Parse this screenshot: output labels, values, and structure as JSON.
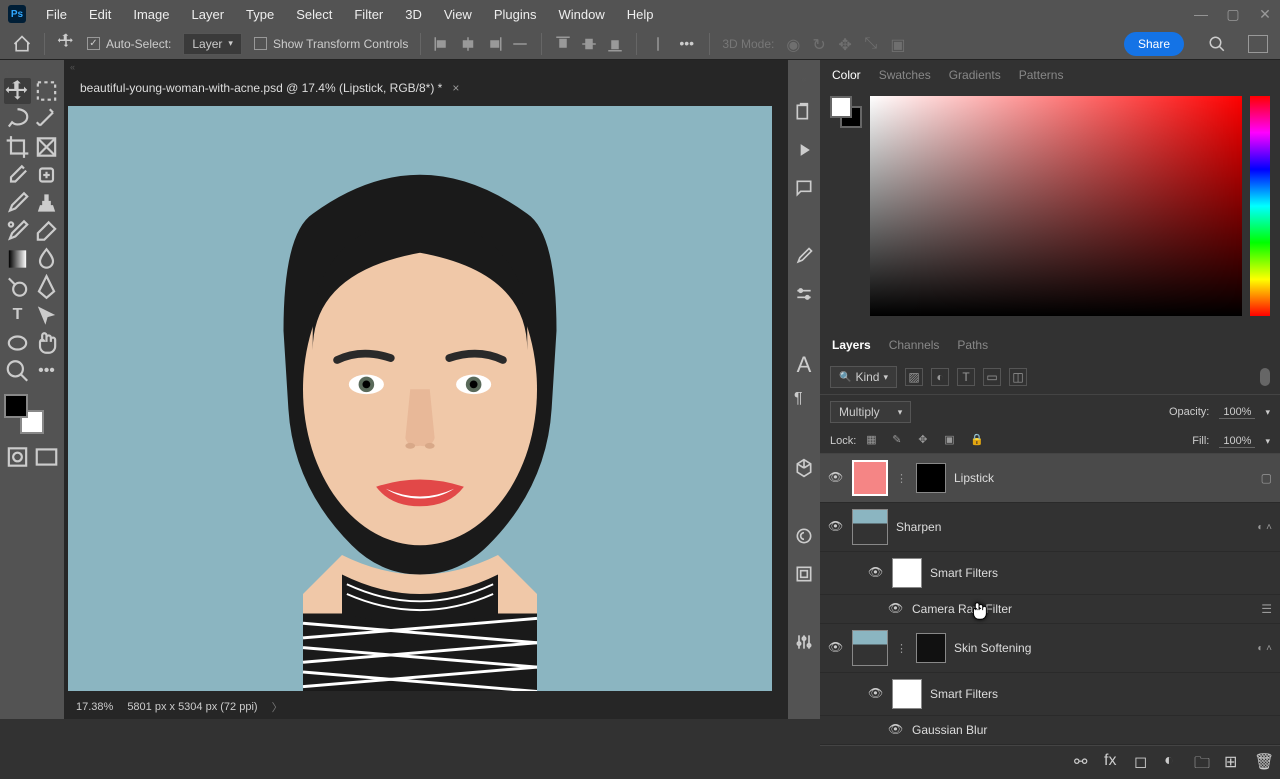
{
  "menu": [
    "File",
    "Edit",
    "Image",
    "Layer",
    "Type",
    "Select",
    "Filter",
    "3D",
    "View",
    "Plugins",
    "Window",
    "Help"
  ],
  "optbar": {
    "auto_select": "Auto-Select:",
    "target": "Layer",
    "show_transform": "Show Transform Controls",
    "mode3d": "3D Mode:",
    "share": "Share"
  },
  "doc": {
    "title": "beautiful-young-woman-with-acne.psd @ 17.4% (Lipstick, RGB/8*) *",
    "zoom": "17.38%",
    "dims": "5801 px x 5304 px (72 ppi)"
  },
  "color_panel": {
    "tabs": [
      "Color",
      "Swatches",
      "Gradients",
      "Patterns"
    ]
  },
  "layers_panel": {
    "tabs": [
      "Layers",
      "Channels",
      "Paths"
    ],
    "kind": "Kind",
    "blend": "Multiply",
    "opacity_lbl": "Opacity:",
    "opacity_val": "100%",
    "lock_lbl": "Lock:",
    "fill_lbl": "Fill:",
    "fill_val": "100%",
    "items": [
      {
        "name": "Lipstick"
      },
      {
        "name": "Sharpen"
      },
      {
        "name": "Smart Filters"
      },
      {
        "name": "Camera Raw Filter"
      },
      {
        "name": "Skin Softening"
      },
      {
        "name": "Smart Filters"
      },
      {
        "name": "Gaussian Blur"
      }
    ]
  }
}
